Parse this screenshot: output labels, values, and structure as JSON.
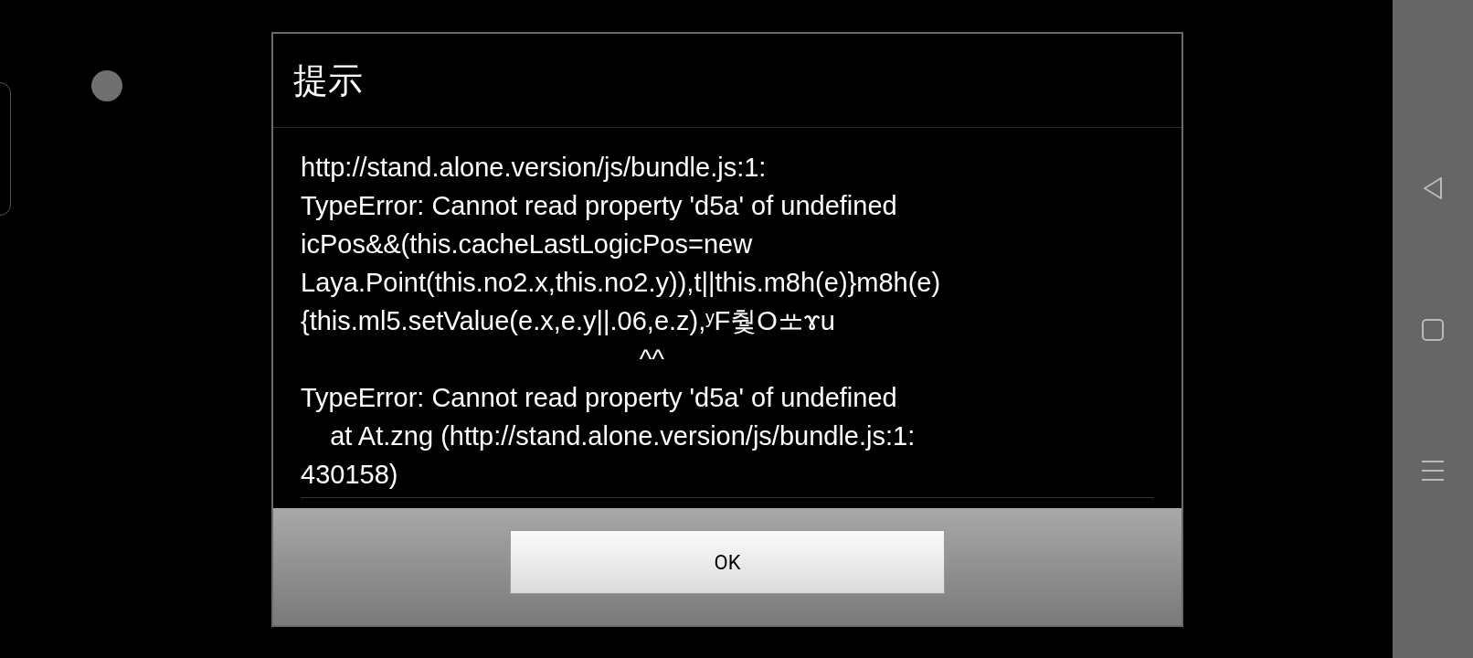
{
  "dialog": {
    "title": "提示",
    "message_lines": [
      "http://stand.alone.version/js/bundle.js:1:",
      "TypeError: Cannot read property 'd5a' of undefined",
      "icPos&&(this.cacheLastLogicPos=new",
      "Laya.Point(this.no2.x,this.no2.y)),t||this.m8h(e)}m8h(e)",
      "{this.ml5.setValue(e.x,e.y||.06,e.z),ʸF췇Oᆇɤu",
      "                                              ^^",
      "TypeError: Cannot read property 'd5a' of undefined",
      "    at At.zng (http://stand.alone.version/js/bundle.js:1:",
      "430158)"
    ],
    "buttons": [
      "OK"
    ]
  }
}
